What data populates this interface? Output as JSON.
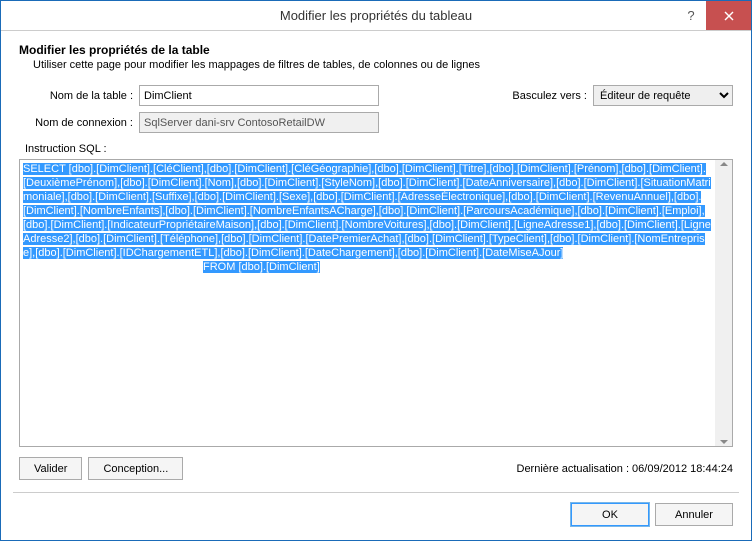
{
  "window": {
    "title": "Modifier les propriétés du tableau"
  },
  "header": {
    "heading": "Modifier les propriétés de la table",
    "subheading": "Utiliser cette page pour modifier les mappages de filtres de tables, de colonnes ou de lignes"
  },
  "form": {
    "table_name_label": "Nom de la table :",
    "table_name_value": "DimClient",
    "connection_label": "Nom de connexion :",
    "connection_value": "SqlServer dani-srv ContosoRetailDW",
    "switch_label": "Basculez vers :",
    "switch_value": "Éditeur de requête",
    "sql_label": "Instruction SQL :",
    "sql_select": "SELECT [dbo].[DimClient].[CléClient],[dbo].[DimClient].[CléGéographie],[dbo].[DimClient].[Titre],[dbo].[DimClient].[Prénom],[dbo].[DimClient].[DeuxièmePrénom],[dbo].[DimClient].[Nom],[dbo].[DimClient].[StyleNom],[dbo].[DimClient].[DateAnniversaire],[dbo].[DimClient].[SituationMatrimoniale],[dbo].[DimClient].[Suffixe],[dbo].[DimClient].[Sexe],[dbo].[DimClient].[AdresseÉlectronique],[dbo].[DimClient].[RevenuAnnuel],[dbo].[DimClient].[NombreEnfants],[dbo].[DimClient].[NombreEnfantsACharge],[dbo].[DimClient].[ParcoursAcadémique],[dbo].[DimClient].[Emploi],[dbo].[DimClient].[IndicateurPropriétaireMaison],[dbo].[DimClient].[NombreVoitures],[dbo].[DimClient].[LigneAdresse1],[dbo].[DimClient].[LigneAdresse2],[dbo].[DimClient].[Téléphone],[dbo].[DimClient].[DatePremierAchat],[dbo].[DimClient].[TypeClient],[dbo].[DimClient].[NomEntreprise],[dbo].[DimClient].[IDChargementETL],[dbo].[DimClient].[DateChargement],[dbo].[DimClient].[DateMiseAJour]",
    "sql_from": "FROM [dbo].[DimClient]"
  },
  "buttons": {
    "validate": "Valider",
    "design": "Conception...",
    "ok": "OK",
    "cancel": "Annuler"
  },
  "status": {
    "last_update": "Dernière actualisation : 06/09/2012 18:44:24"
  }
}
